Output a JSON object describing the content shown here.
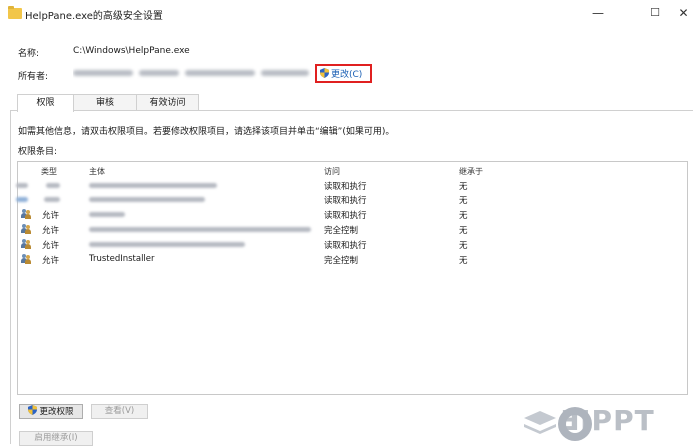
{
  "window": {
    "title": "HelpPane.exe的高级安全设置",
    "minimize_glyph": "—",
    "maximize_glyph": "☐",
    "close_glyph": "✕"
  },
  "info": {
    "name_label": "名称:",
    "name_value": "C:\\Windows\\HelpPane.exe",
    "owner_label": "所有者:",
    "change_link": "更改(C)"
  },
  "tabs": [
    {
      "label": "权限",
      "selected": true
    },
    {
      "label": "审核",
      "selected": false
    },
    {
      "label": "有效访问",
      "selected": false
    }
  ],
  "hint": "如需其他信息，请双击权限项目。若要修改权限项目，请选择该项目并单击“编辑”(如果可用)。",
  "entries_label": "权限条目:",
  "columns": {
    "type": "类型",
    "principal": "主体",
    "access": "访问",
    "inherited": "继承于"
  },
  "rows": [
    {
      "type": "",
      "principal": "",
      "access": "读取和执行",
      "inherited": "无"
    },
    {
      "type": "",
      "principal": "",
      "access": "读取和执行",
      "inherited": "无"
    },
    {
      "type": "允许",
      "principal": "",
      "access": "读取和执行",
      "inherited": "无"
    },
    {
      "type": "允许",
      "principal": "",
      "access": "完全控制",
      "inherited": "无"
    },
    {
      "type": "允许",
      "principal": "",
      "access": "读取和执行",
      "inherited": "无"
    },
    {
      "type": "允许",
      "principal": "TrustedInstaller",
      "access": "完全控制",
      "inherited": "无"
    }
  ],
  "buttons": {
    "change_permissions": "更改权限",
    "view": "查看(V)",
    "enable_inheritance": "启用继承(I)"
  },
  "watermark": "ƎIPPT",
  "colors": {
    "highlight_border": "#e02020",
    "link": "#1a5fb4",
    "folder": "#f2c649"
  }
}
